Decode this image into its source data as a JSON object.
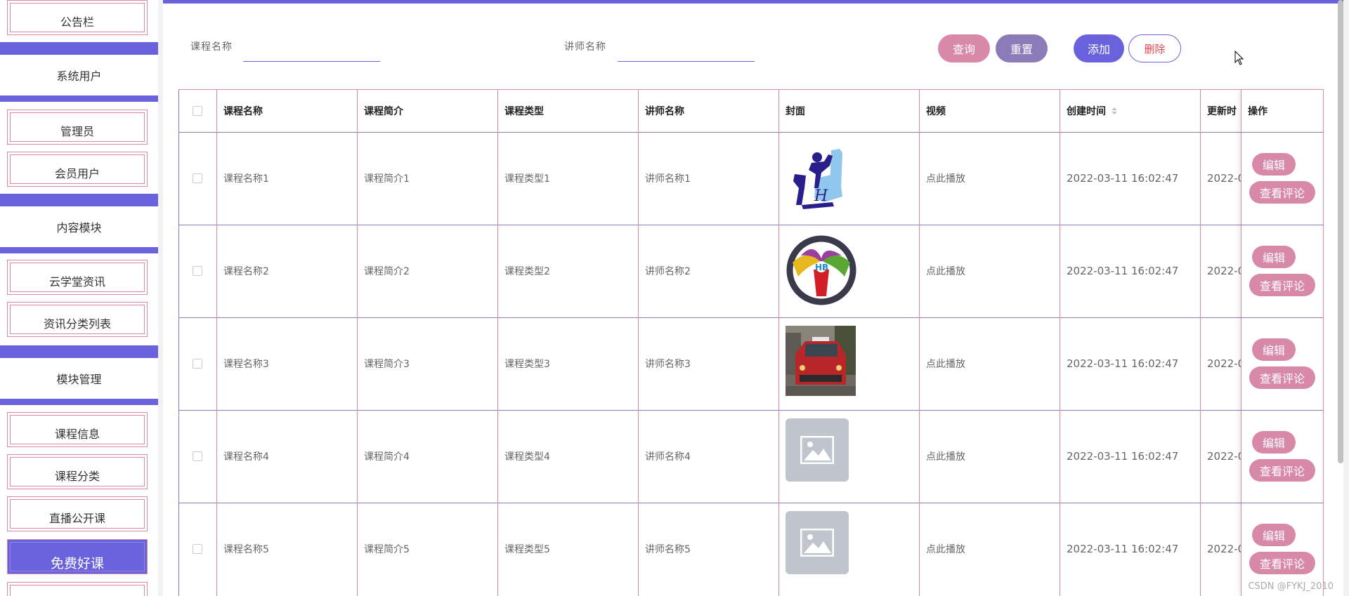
{
  "sidebar": {
    "top_item": "公告栏",
    "groups": [
      {
        "title": "系统用户",
        "items": [
          "管理员",
          "会员用户"
        ]
      },
      {
        "title": "内容模块",
        "items": [
          "云学堂资讯",
          "资讯分类列表"
        ]
      },
      {
        "title": "模块管理",
        "items": [
          "课程信息",
          "课程分类",
          "直播公开课",
          "免费好课"
        ]
      }
    ],
    "active_item": "免费好课"
  },
  "search": {
    "course_label": "课程名称",
    "teacher_label": "讲师名称",
    "course_value": "",
    "teacher_value": ""
  },
  "toolbar": {
    "query": "查询",
    "reset": "重置",
    "add": "添加",
    "delete": "删除"
  },
  "table": {
    "headers": [
      "课程名称",
      "课程简介",
      "课程类型",
      "讲师名称",
      "封面",
      "视频",
      "创建时间",
      "更新时",
      "操作"
    ],
    "rows": [
      {
        "name": "课程名称1",
        "intro": "课程简介1",
        "type": "课程类型1",
        "teacher": "讲师名称1",
        "cover": "seat-logo",
        "video": "点此播放",
        "created": "2022-03-11 16:02:47",
        "updated": "2022-0"
      },
      {
        "name": "课程名称2",
        "intro": "课程简介2",
        "type": "课程类型2",
        "teacher": "讲师名称2",
        "cover": "steering-wheel-logo",
        "video": "点此播放",
        "created": "2022-03-11 16:02:47",
        "updated": "2022-0"
      },
      {
        "name": "课程名称3",
        "intro": "课程简介3",
        "type": "课程类型3",
        "teacher": "讲师名称3",
        "cover": "car-photo",
        "video": "点此播放",
        "created": "2022-03-11 16:02:47",
        "updated": "2022-0"
      },
      {
        "name": "课程名称4",
        "intro": "课程简介4",
        "type": "课程类型4",
        "teacher": "讲师名称4",
        "cover": "image-placeholder",
        "video": "点此播放",
        "created": "2022-03-11 16:02:47",
        "updated": "2022-0"
      },
      {
        "name": "课程名称5",
        "intro": "课程简介5",
        "type": "课程类型5",
        "teacher": "讲师名称5",
        "cover": "image-placeholder",
        "video": "点此播放",
        "created": "2022-03-11 16:02:47",
        "updated": "2022-0"
      }
    ],
    "edit_label": "编辑",
    "review_label": "查看评论"
  },
  "watermark": "CSDN @FYKJ_2010",
  "colors": {
    "accent": "#6a62dc",
    "pink": "#d889a8",
    "mauve": "#8d7ab9",
    "danger": "#e0444a"
  }
}
